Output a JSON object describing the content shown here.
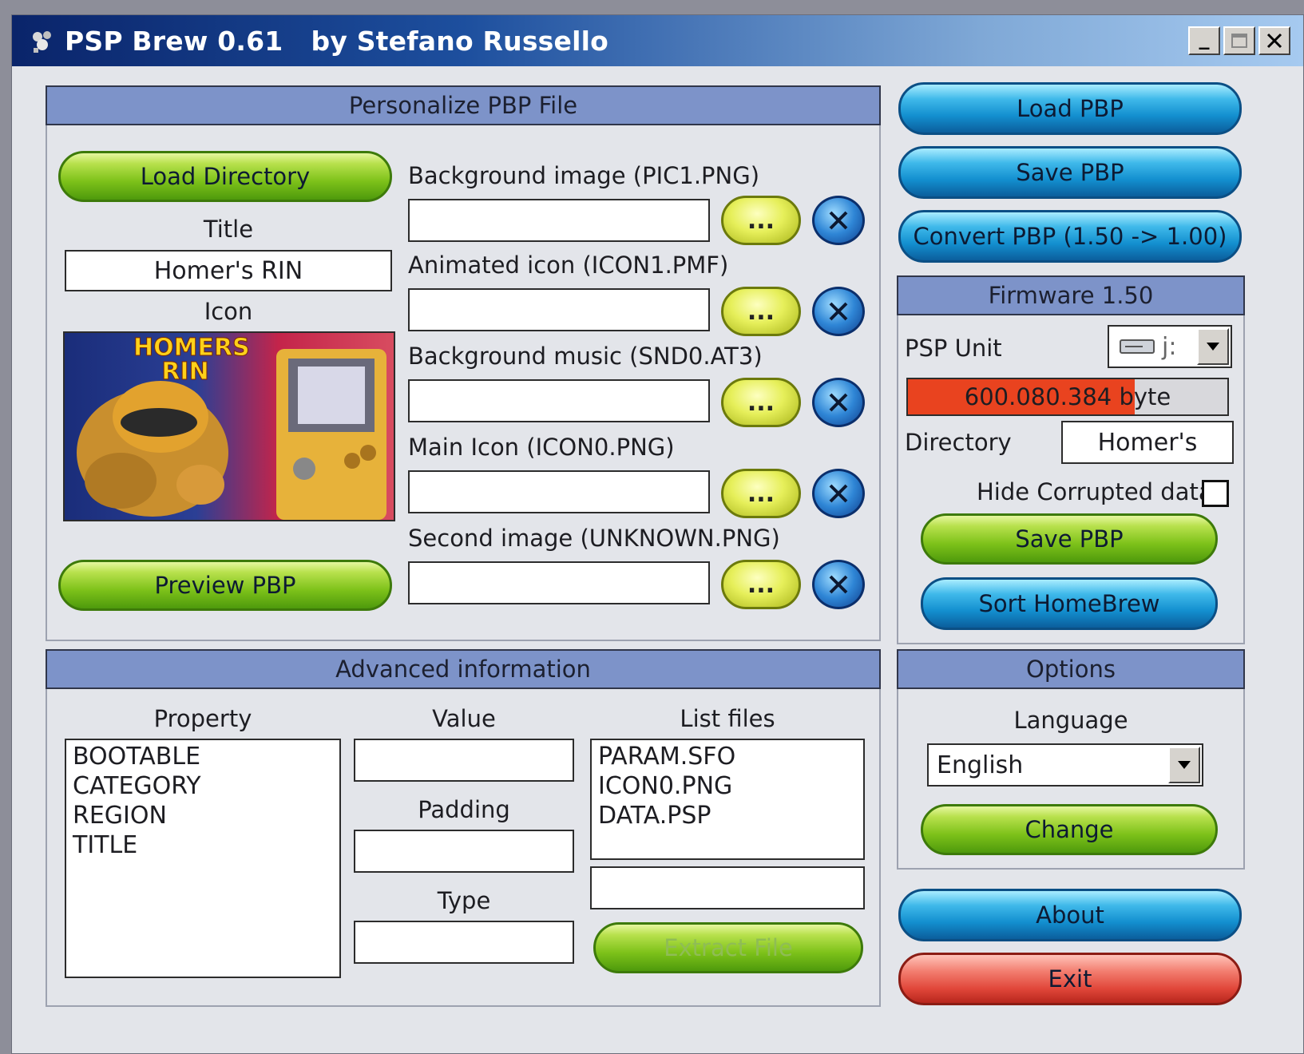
{
  "window": {
    "title": "PSP Brew 0.61   by Stefano Russello",
    "minimize_label": "_"
  },
  "personalize": {
    "header": "Personalize PBP File",
    "load_directory": "Load Directory",
    "title_label": "Title",
    "title_value": "Homer's RIN",
    "icon_label": "Icon",
    "icon_art_text": "HOMERS RIN",
    "preview": "Preview PBP",
    "browse_label": "...",
    "fields": [
      {
        "label": "Background image (PIC1.PNG)",
        "value": ""
      },
      {
        "label": "Animated icon (ICON1.PMF)",
        "value": ""
      },
      {
        "label": "Background music (SND0.AT3)",
        "value": ""
      },
      {
        "label": "Main Icon (ICON0.PNG)",
        "value": ""
      },
      {
        "label": "Second image (UNKNOWN.PNG)",
        "value": ""
      }
    ]
  },
  "actions": {
    "load_pbp": "Load PBP",
    "save_pbp": "Save PBP",
    "convert_pbp": "Convert PBP (1.50 -> 1.00)"
  },
  "firmware": {
    "header": "Firmware 1.50",
    "psp_unit_label": "PSP Unit",
    "psp_unit_value": "j:",
    "space_text": "600.080.384 byte",
    "space_fill": 0.71,
    "directory_label": "Directory",
    "directory_value": "Homer's",
    "hide_corrupted_label": "Hide Corrupted data",
    "hide_corrupted_checked": false,
    "save_pbp": "Save PBP",
    "sort_homebrew": "Sort HomeBrew"
  },
  "advanced": {
    "header": "Advanced information",
    "property_label": "Property",
    "properties": [
      "BOOTABLE",
      "CATEGORY",
      "REGION",
      "TITLE"
    ],
    "value_label": "Value",
    "value": "",
    "padding_label": "Padding",
    "padding": "",
    "type_label": "Type",
    "type": "",
    "list_files_label": "List files",
    "files": [
      "PARAM.SFO",
      "ICON0.PNG",
      "DATA.PSP"
    ],
    "file_name": "",
    "extract_button": "Extract File"
  },
  "options": {
    "header": "Options",
    "language_label": "Language",
    "language_value": "English",
    "change": "Change",
    "about": "About",
    "exit": "Exit"
  },
  "colors": {
    "panel_header": "#7d93c9",
    "progress_fill": "#e9431f",
    "titlebar_start": "#0a246a",
    "titlebar_end": "#a6caf0"
  }
}
